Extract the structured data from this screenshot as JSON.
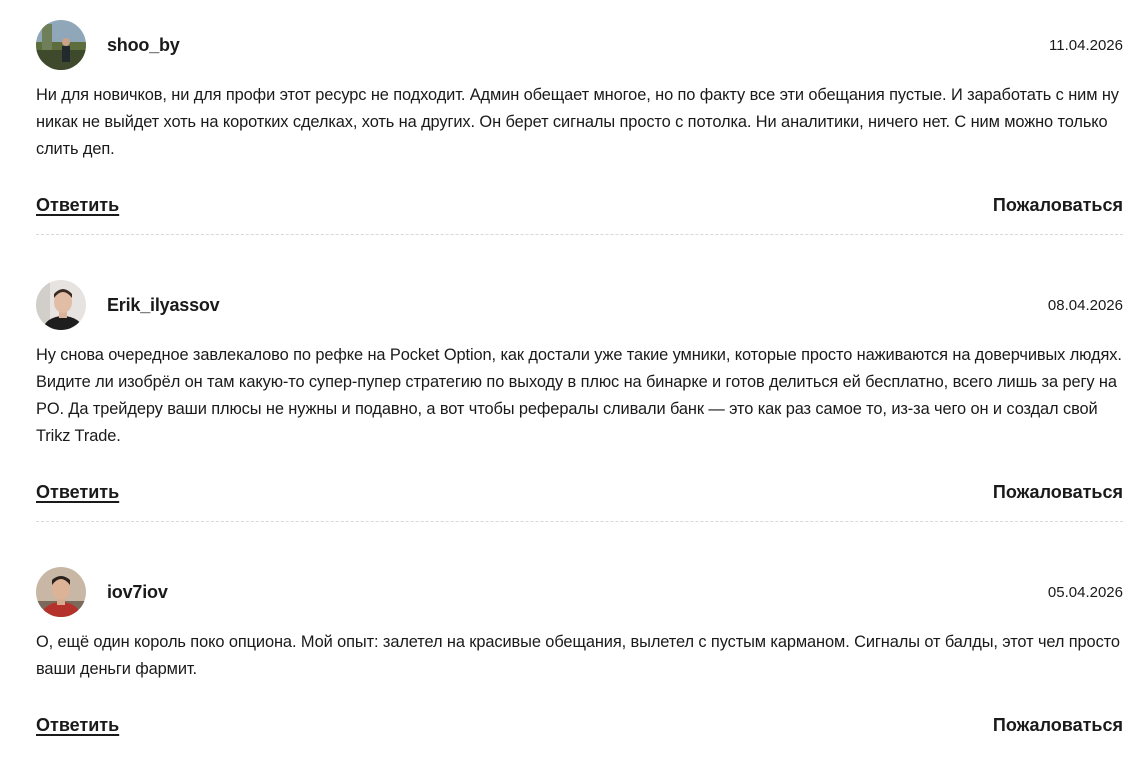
{
  "comments": [
    {
      "username": "shoo_by",
      "date": "11.04.2026",
      "text": "Ни для новичков, ни для профи этот ресурс не подходит. Админ обещает многое, но по факту все эти обещания пустые. И заработать с ним ну никак не выйдет хоть на коротких сделках, хоть на других. Он берет сигналы просто с потолка. Ни аналитики, ничего нет. С ним можно только слить деп.",
      "reply_label": "Ответить",
      "report_label": "Пожаловаться"
    },
    {
      "username": "Erik_ilyassov",
      "date": "08.04.2026",
      "text": "Ну снова очередное завлекалово по рефке на Pocket Option, как достали уже такие умники, которые просто наживаются на доверчивых людях. Видите ли изобрёл он там какую-то супер-пупер стратегию по выходу в плюс на бинарке и готов делиться ей бесплатно, всего лишь за регу на PO. Да трейдеру ваши плюсы не нужны и подавно, а вот чтобы рефералы сливали банк — это как раз самое то, из-за чего он и создал свой Trikz Trade.",
      "reply_label": "Ответить",
      "report_label": "Пожаловаться"
    },
    {
      "username": "iov7iov",
      "date": "05.04.2026",
      "text": "О, ещё один король поко опциона. Мой опыт: залетел на красивые обещания, вылетел с пустым карманом. Сигналы от балды, этот чел просто ваши деньги фармит.",
      "reply_label": "Ответить",
      "report_label": "Пожаловаться"
    }
  ]
}
